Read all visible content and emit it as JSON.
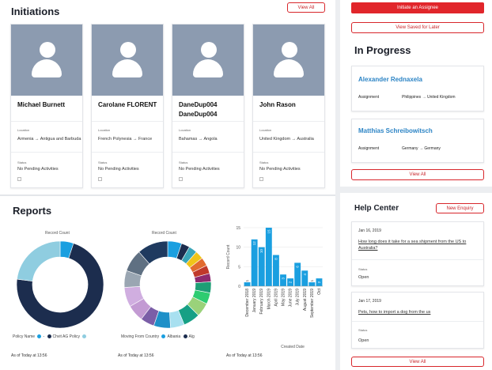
{
  "initiations": {
    "title": "Initiations",
    "view_all": "View All",
    "cards": [
      {
        "name": "Michael Burnett",
        "location_label": "Location",
        "location": "Armenia → Antigua and Barbuda",
        "status_label": "Status",
        "status": "No Pending Activities"
      },
      {
        "name": "Carolane FLORENT",
        "location_label": "Location",
        "location": "French Polynesia → France",
        "status_label": "Status",
        "status": "No Pending Activities"
      },
      {
        "name": "DaneDup004 DaneDup004",
        "location_label": "Location",
        "location": "Bahamas → Angola",
        "status_label": "Status",
        "status": "No Pending Activities"
      },
      {
        "name": "John Rason",
        "location_label": "Location",
        "location": "United Kingdom → Australia",
        "status_label": "Status",
        "status": "No Pending Activities"
      }
    ]
  },
  "reports": {
    "title": "Reports",
    "as_of": "As of Today at 13:56"
  },
  "chart_data": [
    {
      "type": "pie",
      "title": "Record Count",
      "legend_title": "Policy Name",
      "categories": [
        "-",
        "Chvit AG Policy",
        ""
      ],
      "values": [
        5,
        72,
        23
      ],
      "colors": [
        "#1a9fe0",
        "#1c2d4e",
        "#8fcde0"
      ]
    },
    {
      "type": "pie",
      "title": "Record Count",
      "legend_title": "Moving From Country",
      "categories": [
        "Albania",
        "Alg"
      ],
      "values": [
        5,
        3,
        3,
        3,
        3,
        3,
        3,
        4,
        4,
        5,
        6,
        5,
        6,
        5,
        6,
        7,
        6,
        8,
        11
      ],
      "colors": [
        "#1a9fe0",
        "#1c2d4e",
        "#3aa6b9",
        "#f0c419",
        "#e26b2f",
        "#c0392b",
        "#8e2a6e",
        "#1e9e75",
        "#2ecc71",
        "#9ad27a",
        "#16a085",
        "#a8e0f0",
        "#1e90c8",
        "#7b5ea7",
        "#c39bd3",
        "#d0aee0",
        "#9aa6b2",
        "#5f7082",
        "#1f3a5f"
      ]
    },
    {
      "type": "bar",
      "ylabel": "Record Count",
      "xlabel": "Created Date",
      "ylim": [
        0,
        15
      ],
      "yticks": [
        0,
        5,
        10,
        15
      ],
      "categories": [
        "December 2018",
        "January 2019",
        "February 2019",
        "March 2019",
        "April 2019",
        "May 2019",
        "June 2019",
        "July 2019",
        "August 2019",
        "September 2019",
        "Oct"
      ],
      "values": [
        1,
        12,
        10,
        15,
        8,
        3,
        2,
        6,
        4,
        1,
        2
      ],
      "labels": [
        "1",
        "12",
        "10",
        "15",
        "8",
        "3",
        "2",
        "6",
        "4",
        "1",
        "2"
      ],
      "color": "#1a9fe0"
    }
  ],
  "sidebar": {
    "initiate_label": "Initiate an Assignee",
    "saved_label": "View Saved for Later",
    "in_progress_title": "In Progress",
    "in_progress": [
      {
        "name": "Alexander Rednaxela",
        "label": "Assignment",
        "route": "Philippines → United Kingdom"
      },
      {
        "name": "Matthias Schreibowitsch",
        "label": "Assignment",
        "route": "Germany → Germany"
      }
    ],
    "view_all": "View All",
    "help_title": "Help Center",
    "new_enquiry": "New Enquiry",
    "enquiries": [
      {
        "date": "Jan 16, 2019",
        "question": "How long does it take for a sea shipment from the US to Australia?",
        "status_label": "Status",
        "status": "Open"
      },
      {
        "date": "Jan 17, 2019",
        "question": "Pets, how to import a dog from the us",
        "status_label": "Status",
        "status": "Open"
      }
    ],
    "help_view_all": "View All"
  }
}
